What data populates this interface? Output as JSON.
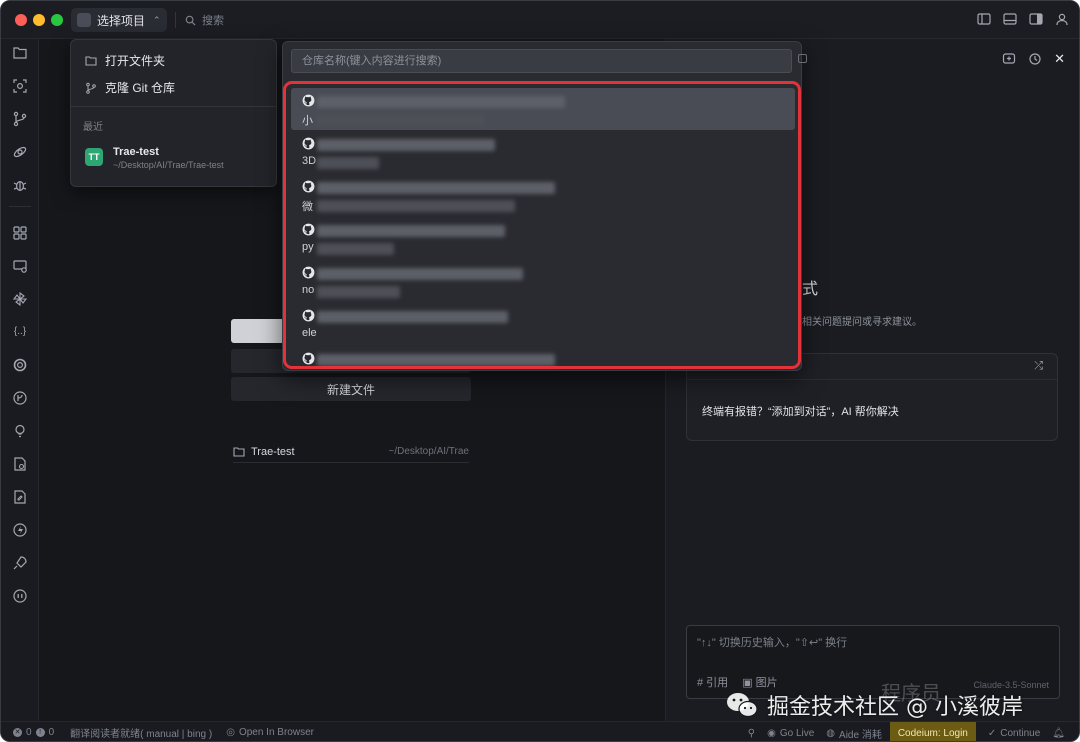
{
  "titlebar": {
    "project_button": "选择项目",
    "search_label": "搜索"
  },
  "project_menu": {
    "open_folder": "打开文件夹",
    "clone_repo": "克隆 Git 仓库",
    "recent_heading": "最近",
    "recent": [
      {
        "avatar": "TT",
        "name": "Trae-test",
        "path": "~/Desktop/AI/Trae/Trae-test"
      }
    ]
  },
  "repo_picker": {
    "search_placeholder": "仓库名称(键入内容进行搜索)",
    "items": [
      {
        "prefix": "小",
        "selected": true
      },
      {
        "prefix": "3D",
        "selected": false
      },
      {
        "prefix": "微",
        "selected": false
      },
      {
        "prefix": "py",
        "selected": false
      },
      {
        "prefix": "no",
        "selected": false
      },
      {
        "prefix": "ele",
        "selected": false
      },
      {
        "prefix": "",
        "selected": false
      }
    ]
  },
  "left_pane": {
    "new_file_button": "新建文件",
    "recent_project": {
      "name": "Trae-test",
      "path": "~/Desktop/AI/Trae"
    }
  },
  "right_pane": {
    "title_fragment": "式",
    "subtitle_fragment": "相关问题提问或寻求建议。",
    "card_text": "终端有报错？“添加到对话”，AI 帮你解决",
    "input_placeholder": "\"↑↓\" 切换历史输入，\"⇧↩\" 换行",
    "tool_ref": "# 引用",
    "tool_image": "图片",
    "model": "Claude-3.5-Sonnet"
  },
  "statusbar": {
    "errors": "0",
    "warnings": "0",
    "translate_status": "翻译阅读者就绪( manual | bing )",
    "open_in_browser": "Open In Browser",
    "go_live": "Go Live",
    "aide": "Aide 消耗",
    "codeium": "Codeium: Login",
    "continue": "Continue"
  },
  "watermark": {
    "text": "掘金技术社区 @ 小溪彼岸",
    "background_text": "程序员"
  },
  "colors": {
    "highlight": "#e2333a",
    "codeium_bg": "#6b5b13",
    "avatar_green": "#2ea673"
  }
}
